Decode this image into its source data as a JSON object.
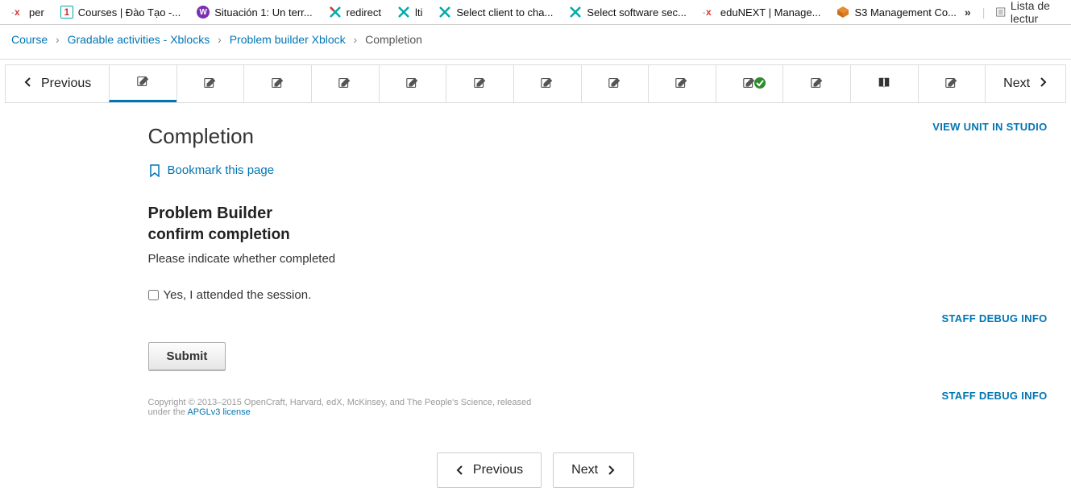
{
  "browser_tabs": [
    {
      "icon": "edunext",
      "label": "per"
    },
    {
      "icon": "one",
      "label": "Courses | Đào Tạo -..."
    },
    {
      "icon": "w",
      "label": "Situación 1: Un terr..."
    },
    {
      "icon": "x",
      "label": "redirect"
    },
    {
      "icon": "x",
      "label": "lti"
    },
    {
      "icon": "x",
      "label": "Select client to cha..."
    },
    {
      "icon": "x",
      "label": "Select software sec..."
    },
    {
      "icon": "edunext",
      "label": "eduNEXT | Manage..."
    },
    {
      "icon": "cube",
      "label": "S3 Management Co..."
    }
  ],
  "reading_list": "Lista de lectur",
  "breadcrumb": {
    "items": [
      "Course",
      "Gradable activities - Xblocks",
      "Problem builder Xblock"
    ],
    "current": "Completion"
  },
  "seqnav": {
    "previous": "Previous",
    "next": "Next",
    "units": [
      {
        "type": "edit",
        "active": true
      },
      {
        "type": "edit"
      },
      {
        "type": "edit"
      },
      {
        "type": "edit"
      },
      {
        "type": "edit"
      },
      {
        "type": "edit"
      },
      {
        "type": "edit"
      },
      {
        "type": "edit"
      },
      {
        "type": "edit"
      },
      {
        "type": "edit",
        "complete": true
      },
      {
        "type": "edit"
      },
      {
        "type": "book"
      },
      {
        "type": "edit"
      }
    ]
  },
  "page": {
    "title": "Completion",
    "bookmark": "Bookmark this page",
    "pb_title": "Problem Builder",
    "pb_subtitle": "confirm completion",
    "prompt": "Please indicate whether completed",
    "checkbox_label": "Yes, I attended the session.",
    "submit": "Submit",
    "copyright_prefix": "Copyright © 2013–2015 OpenCraft, Harvard, edX, McKinsey, and The People's Science, released under the ",
    "copyright_link": "APGLv3 license"
  },
  "links": {
    "view_studio": "VIEW UNIT IN STUDIO",
    "staff_debug": "STAFF DEBUG INFO"
  },
  "bottom": {
    "previous": "Previous",
    "next": "Next"
  }
}
